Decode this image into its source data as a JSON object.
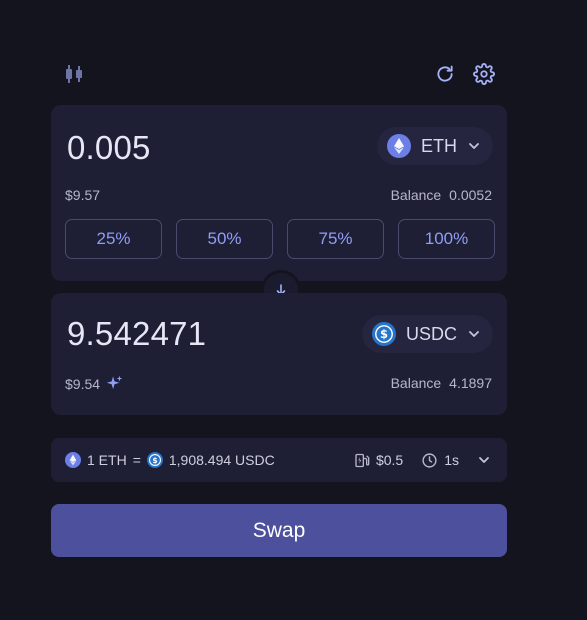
{
  "sell": {
    "amount": "0.005",
    "token": "ETH",
    "usd_value": "$9.57",
    "balance_label": "Balance",
    "balance_value": "0.0052",
    "percent_buttons": [
      "25%",
      "50%",
      "75%",
      "100%"
    ]
  },
  "buy": {
    "amount": "9.542471",
    "token": "USDC",
    "usd_value": "$9.54",
    "balance_label": "Balance",
    "balance_value": "4.1897"
  },
  "rate": {
    "from": "1 ETH",
    "equals": "=",
    "to": "1,908.494 USDC",
    "gas_fee": "$0.5",
    "time": "1s"
  },
  "swap_label": "Swap",
  "colors": {
    "background": "#14141f",
    "panel": "#1e1e35",
    "accent": "#8f9ef5",
    "swap_button": "#4c509d",
    "eth": "#6b7fe6",
    "usdc": "#2775ca"
  },
  "icons": [
    "candlestick-chart-icon",
    "refresh-icon",
    "gear-icon",
    "eth-icon",
    "usdc-icon",
    "chevron-down-icon",
    "arrow-down-icon",
    "sparkle-icon",
    "gas-pump-icon",
    "clock-icon"
  ]
}
